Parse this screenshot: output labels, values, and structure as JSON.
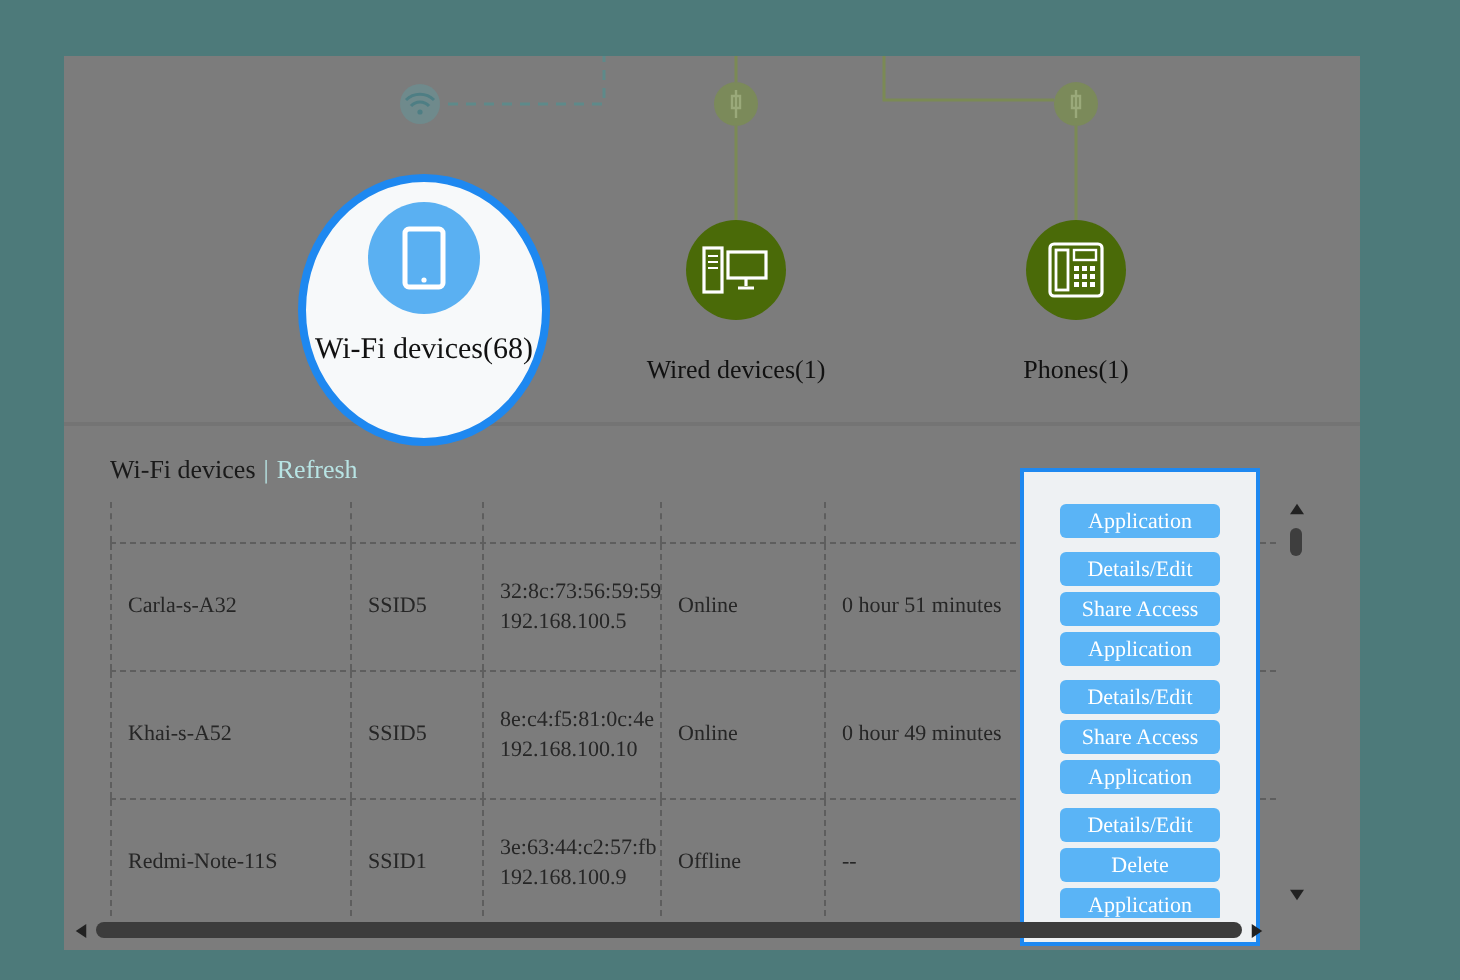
{
  "diagram": {
    "nodes": [
      {
        "kind": "wifi",
        "label": "Wi-Fi devices(68)",
        "selected": true
      },
      {
        "kind": "wired",
        "label": "Wired devices(1)",
        "selected": false
      },
      {
        "kind": "phone",
        "label": "Phones(1)",
        "selected": false
      }
    ]
  },
  "section": {
    "title": "Wi-Fi devices",
    "separator": "|",
    "link": "Refresh"
  },
  "table": {
    "rows": [
      {
        "kind": "partial",
        "actions": [
          "Application"
        ]
      },
      {
        "kind": "full",
        "name": "Carla-s-A32",
        "ssid": "SSID5",
        "mac": "32:8c:73:56:59:59",
        "ip": "192.168.100.5",
        "status": "Online",
        "duration": "0 hour 51 minutes",
        "actions": [
          "Details/Edit",
          "Share Access",
          "Application"
        ]
      },
      {
        "kind": "full",
        "name": "Khai-s-A52",
        "ssid": "SSID5",
        "mac": "8e:c4:f5:81:0c:4e",
        "ip": "192.168.100.10",
        "status": "Online",
        "duration": "0 hour 49 minutes",
        "actions": [
          "Details/Edit",
          "Share Access",
          "Application"
        ]
      },
      {
        "kind": "full",
        "name": "Redmi-Note-11S",
        "ssid": "SSID1",
        "mac": "3e:63:44:c2:57:fb",
        "ip": "192.168.100.9",
        "status": "Offline",
        "duration": "--",
        "actions": [
          "Details/Edit",
          "Delete",
          "Application"
        ]
      }
    ]
  }
}
